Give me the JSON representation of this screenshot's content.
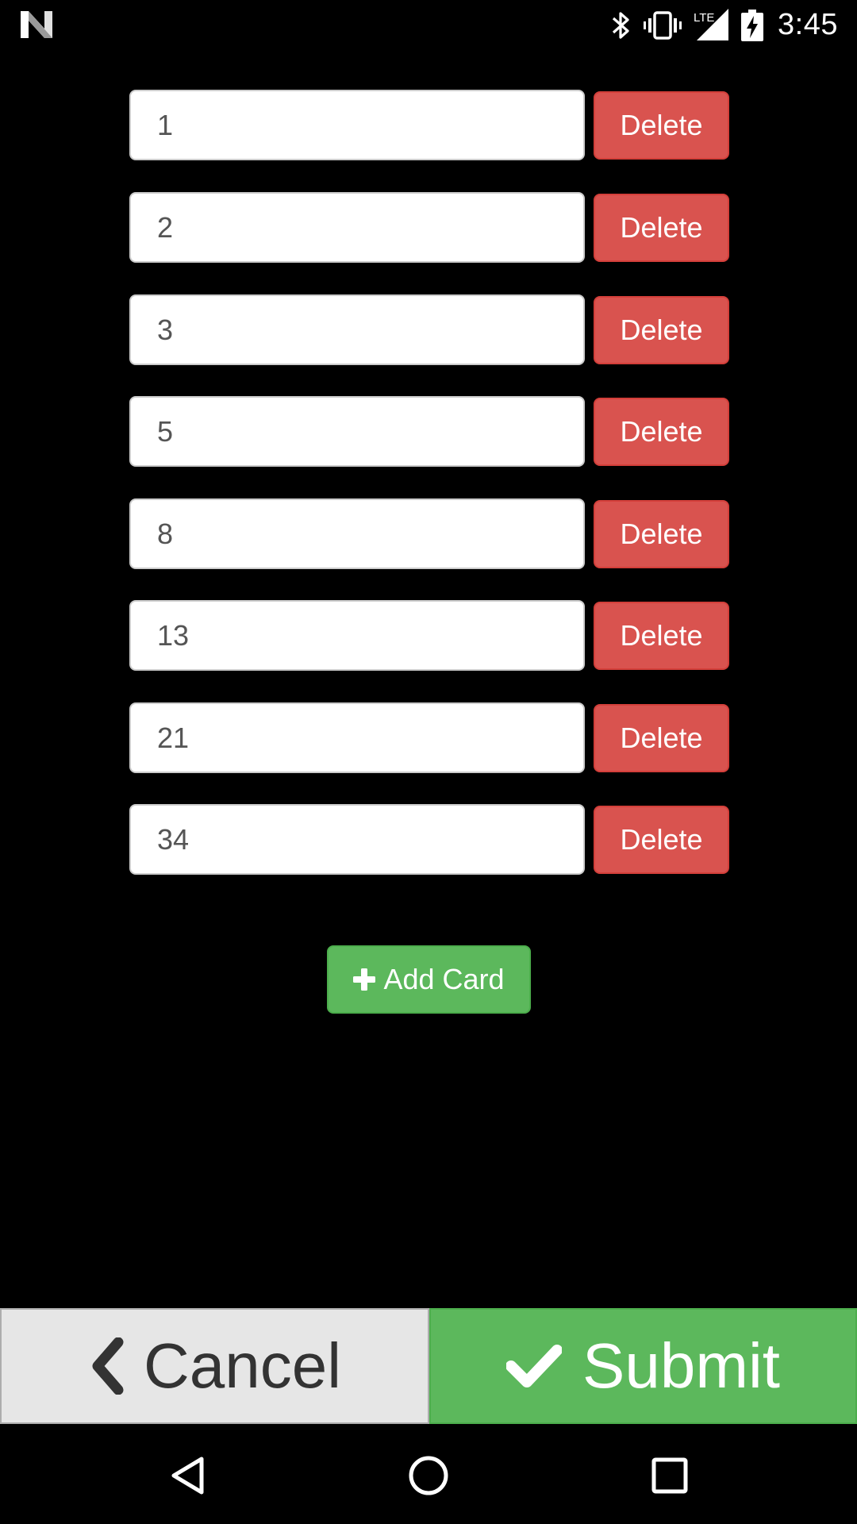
{
  "status_bar": {
    "time": "3:45",
    "icons": [
      "n-logo-icon",
      "bluetooth-icon",
      "vibrate-icon",
      "lte-signal-icon",
      "battery-charging-icon"
    ],
    "network_label": "LTE"
  },
  "cards": [
    {
      "value": "1",
      "delete_label": "Delete"
    },
    {
      "value": "2",
      "delete_label": "Delete"
    },
    {
      "value": "3",
      "delete_label": "Delete"
    },
    {
      "value": "5",
      "delete_label": "Delete"
    },
    {
      "value": "8",
      "delete_label": "Delete"
    },
    {
      "value": "13",
      "delete_label": "Delete"
    },
    {
      "value": "21",
      "delete_label": "Delete"
    },
    {
      "value": "34",
      "delete_label": "Delete"
    }
  ],
  "add_card": {
    "label": "Add Card",
    "icon": "plus-icon"
  },
  "actions": {
    "cancel_label": "Cancel",
    "cancel_icon": "chevron-left-icon",
    "submit_label": "Submit",
    "submit_icon": "checkmark-icon"
  },
  "nav_bar": {
    "icons": [
      "back-icon",
      "home-icon",
      "recents-icon"
    ]
  },
  "colors": {
    "background": "#000000",
    "delete": "#d9534f",
    "success": "#5cb85c",
    "cancel_bg": "#e6e6e6"
  }
}
